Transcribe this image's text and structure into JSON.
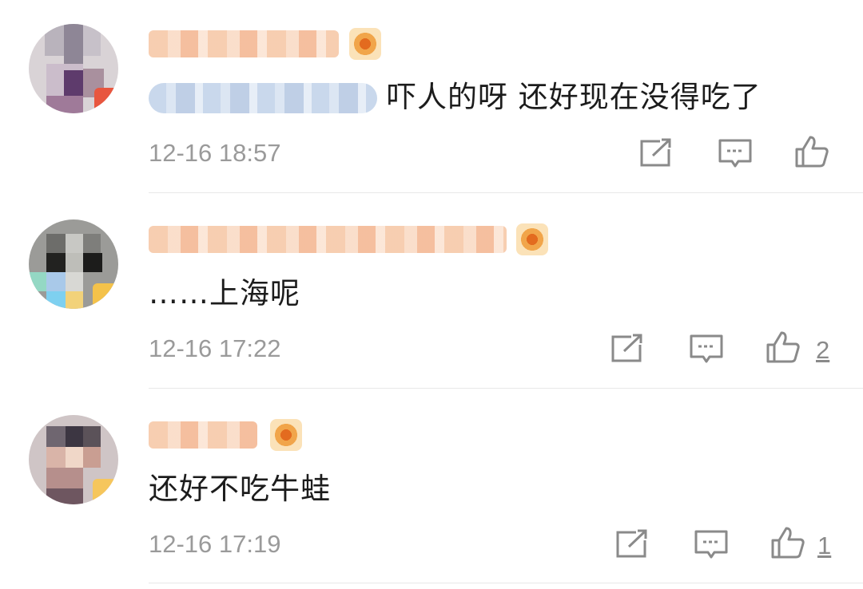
{
  "comments": [
    {
      "text": "吓人的呀 还好现在没得吃了",
      "time": "12-16 18:57",
      "likes": ""
    },
    {
      "text": "……上海呢",
      "time": "12-16 17:22",
      "likes": "2"
    },
    {
      "text": "还好不吃牛蛙",
      "time": "12-16 17:19",
      "likes": "1"
    }
  ],
  "icons": {
    "share": "share-icon",
    "comment": "comment-icon",
    "like": "like-icon"
  },
  "colors": {
    "time_gray": "#9a9a9a",
    "icon_gray": "#8a8a8a",
    "divider": "#e8e8e8",
    "name_blur": "#f6c8a8",
    "mention_blur": "#c9d8ec"
  }
}
